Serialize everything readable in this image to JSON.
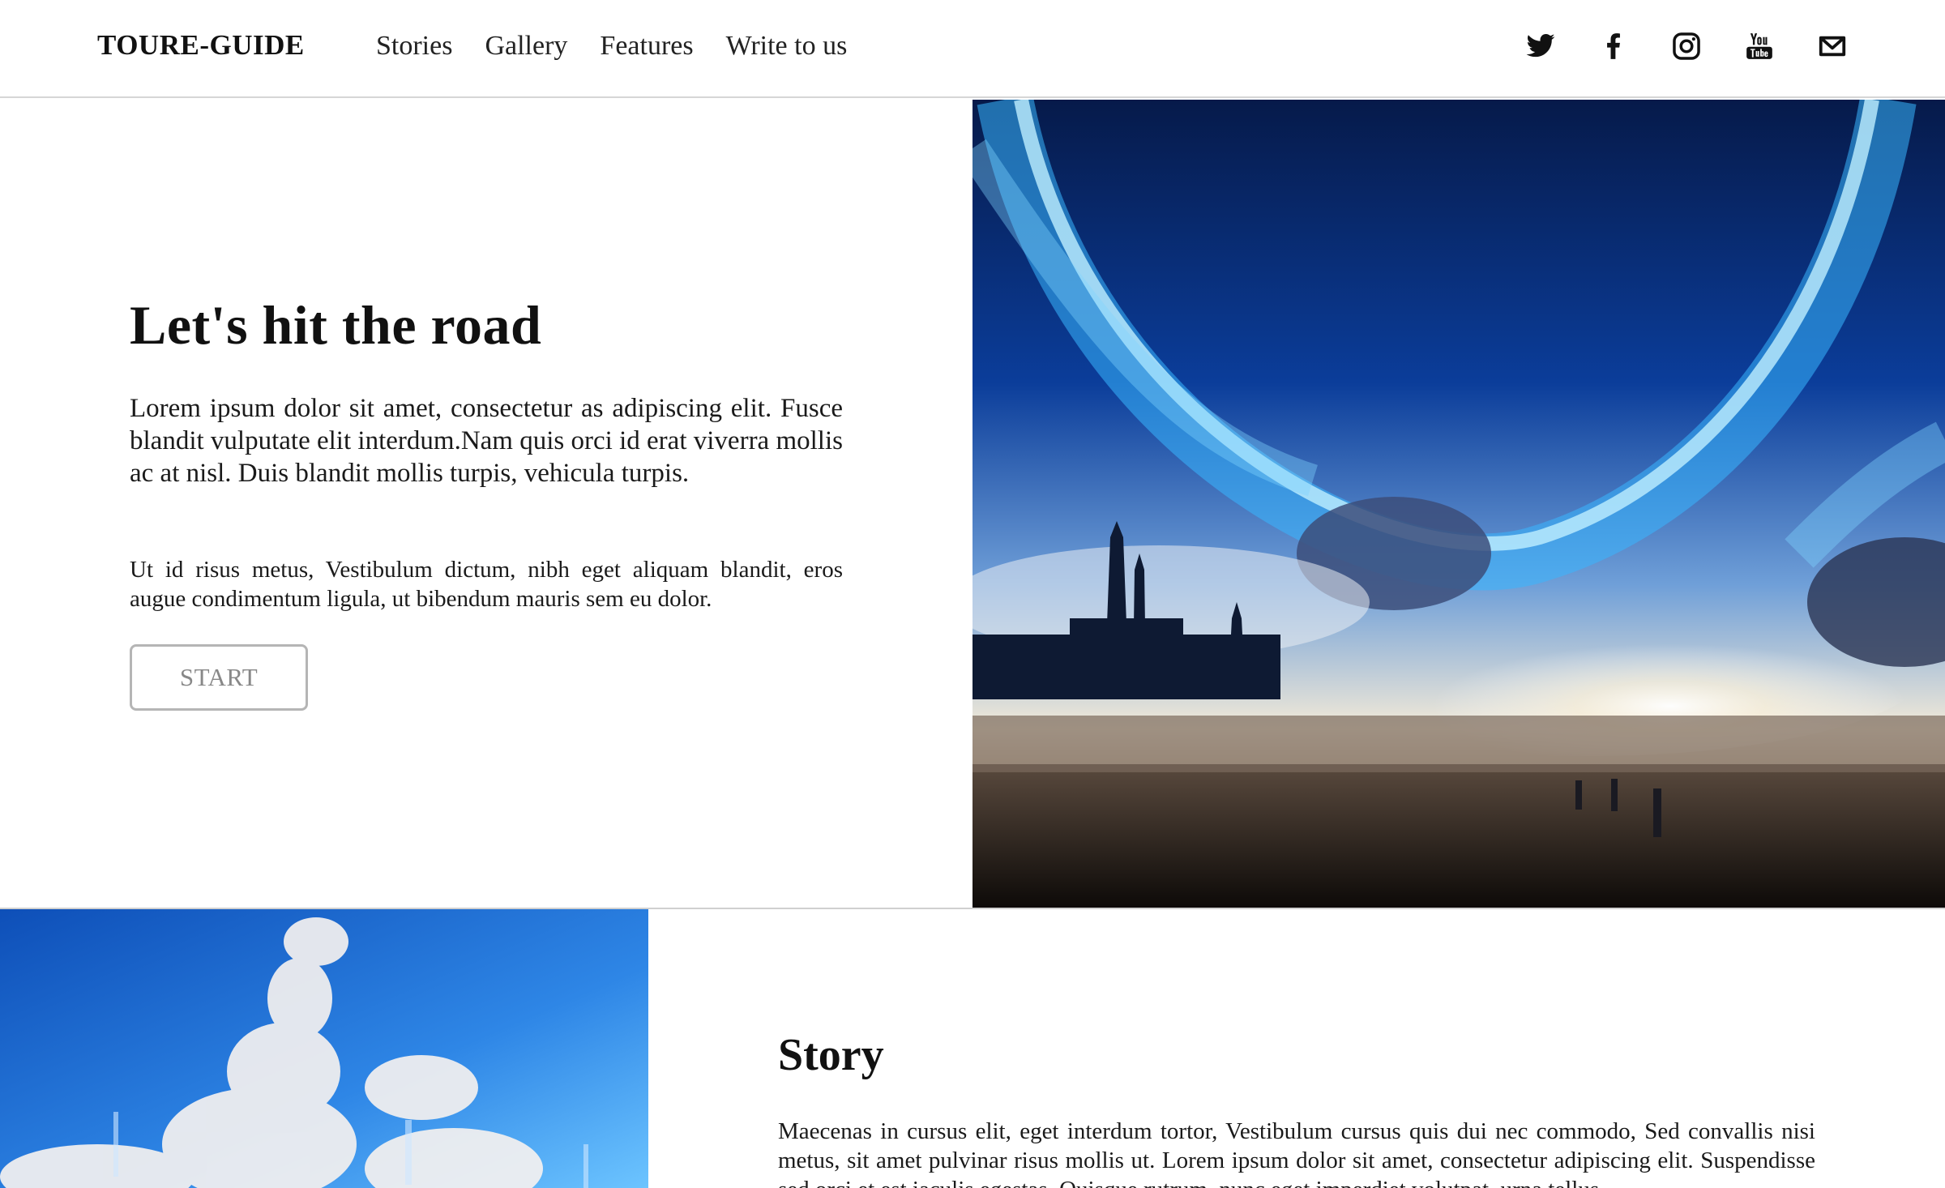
{
  "header": {
    "logo": "TOURE-GUIDE",
    "nav": [
      "Stories",
      "Gallery",
      "Features",
      "Write to us"
    ],
    "social_icons": [
      "twitter-icon",
      "facebook-icon",
      "instagram-icon",
      "youtube-icon",
      "mail-icon"
    ]
  },
  "hero": {
    "title": "Let's hit the road",
    "paragraph1": "Lorem ipsum dolor sit amet, consectetur as adipiscing elit. Fusce blandit vulputate elit interdum.Nam quis orci id erat viverra mollis ac at nisl. Duis blandit mollis turpis, vehicula turpis.",
    "paragraph2": "Ut id risus metus, Vestibulum dictum, nibh eget aliquam blandit, eros augue condimentum ligula, ut bibendum mauris sem eu dolor.",
    "button_label": "START"
  },
  "story": {
    "title": "Story",
    "text": "Maecenas in cursus elit, eget interdum tortor, Vestibulum cursus quis dui nec commodo, Sed convallis nisi metus, sit amet pulvinar risus mollis ut. Lorem ipsum dolor sit amet, consectetur adipiscing elit. Suspendisse sed orci et est iaculis egestas. Quisque rutrum, nunc eget imperdiet volutpat, urna tellus"
  },
  "colors": {
    "text": "#111111",
    "button_border": "#b5b5b5",
    "button_text": "#888888",
    "divider": "#d0d0d0"
  }
}
